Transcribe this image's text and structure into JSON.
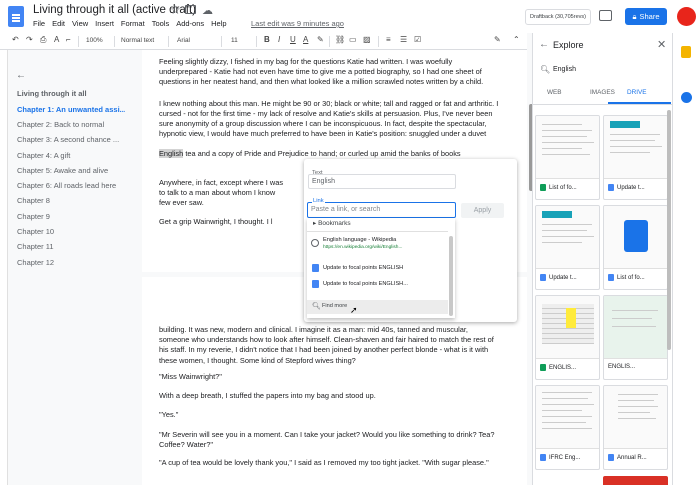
{
  "app": {
    "title": "Living through it all (active draft)",
    "last_edit": "Last edit was 9 minutes ago",
    "draftback": "Draftback (30,705revs)",
    "share": "Share"
  },
  "menu": [
    "File",
    "Edit",
    "View",
    "Insert",
    "Format",
    "Tools",
    "Add-ons",
    "Help"
  ],
  "toolbar": {
    "zoom": "100%",
    "style": "Normal text",
    "font": "Arial",
    "size": "11"
  },
  "outline": {
    "items": [
      "Living through it all",
      "Chapter 1: An unwanted assi...",
      "Chapter 2: Back to normal",
      "Chapter 3: A second chance ...",
      "Chapter 4: A gift",
      "Chapter 5: Awake and alive",
      "Chapter 6: All roads lead here",
      "Chapter 8",
      "Chapter 9",
      "Chapter 10",
      "Chapter 11",
      "Chapter 12"
    ]
  },
  "doc": {
    "p1": "Feeling slightly dizzy, I fished in my bag for the questions Katie had written. I was woefully underprepared - Katie had not even have time to give me a potted biography, so I had one sheet of questions in her neatest hand, and then what looked like a million scrawled notes written by a child.",
    "p2a": "I knew nothing about this man. He might be 90 or 30; black or white; tall and ragged or fat and arthritic. I cursed - not for the first time - my lack of resolve and Katie's skills at persuasion. Plus, I've never been comfortable with one-on-one interviews with strangers, preferring instead to",
    "p2b": "sure anonymity of a group discussion where I can be inconspicuous. In fact, despite the spectacular, hypnotic view, I would have much preferred to have been in Katie's position: snuggled under a duvet with a cup of",
    "p2sel": "English",
    "p2c": "tea and a copy of Pride and Prejudice to hand; or curled up amid the banks of books",
    "p3": "Anywhere, in fact, except where I was",
    "p3b": "to talk to a man about whom I know",
    "p3c": "few ever saw.",
    "p4": "Get a grip Wainwright, I thought. I l",
    "page_num": "3",
    "p5": "building. It was new, modern and clinical. I imagine it as a man: mid 40s, tanned and muscular, someone who understands how to look after himself. Clean-shaven and fair haired to match the rest of his staff. In my reverie, I didn't notice that I had been joined by another perfect blonde - what is it with these women, I thought. Some kind of Stepford wives thing?",
    "p6": "\"Miss Wainwright?\"",
    "p7": "With a deep breath, I stuffed the papers into my bag and stood up.",
    "p8": "\"Yes.\"",
    "p9": "\"Mr Severin will see you in a moment. Can I take your jacket? Would you like something to drink? Tea? Coffee? Water?\"",
    "p10": "\"A cup of tea would be lovely thank you,\" I said as I removed my too tight jacket. \"With sugar please.\""
  },
  "link_dialog": {
    "text_label": "Text",
    "text_value": "English",
    "link_label": "Link",
    "link_placeholder": "Paste a link, or search",
    "apply": "Apply",
    "bookmarks": "Bookmarks",
    "wiki_title": "English language - Wikipedia",
    "wiki_url": "https://en.wikipedia.org/wiki/English...",
    "item1": "Update to focal points ENGLISH",
    "item2": "Update to focal points ENGLISH...",
    "find_more": "Find more"
  },
  "explore": {
    "title": "Explore",
    "search": "English",
    "tabs": [
      "WEB",
      "IMAGES",
      "DRIVE"
    ],
    "cards": [
      {
        "label": "List of fo...",
        "icon": "g"
      },
      {
        "label": "Update t...",
        "icon": "b"
      },
      {
        "label": "Update t...",
        "icon": "b"
      },
      {
        "label": "List of fo...",
        "icon": "b"
      },
      {
        "label": "ENGLIS...",
        "icon": "g"
      },
      {
        "label": "ENGLIS...",
        "icon": "p"
      },
      {
        "label": "IFRC Eng...",
        "icon": "b"
      },
      {
        "label": "Annual R...",
        "icon": "b"
      }
    ]
  }
}
